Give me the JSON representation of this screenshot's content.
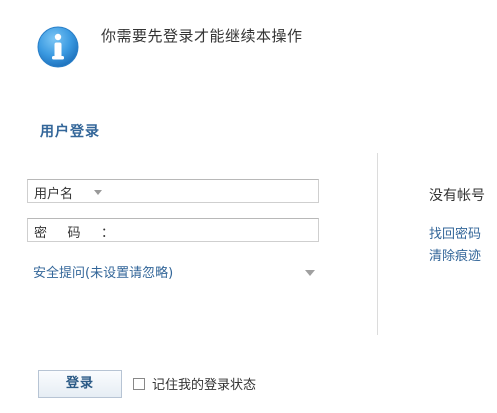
{
  "notice": {
    "icon": "info-icon",
    "message": "你需要先登录才能继续本操作"
  },
  "login": {
    "title": "用户登录",
    "username_label": "用户名",
    "password_label_chars": [
      "密",
      "码",
      "："
    ],
    "security_question": "安全提问(未设置请忽略)",
    "submit_label": "登录",
    "remember_label": "记住我的登录状态"
  },
  "side": {
    "no_account": "没有帐号",
    "find_password": "找回密码",
    "clear_traces": "清除痕迹"
  },
  "colors": {
    "accent": "#336699",
    "icon_blue": "#3b9ae1"
  }
}
